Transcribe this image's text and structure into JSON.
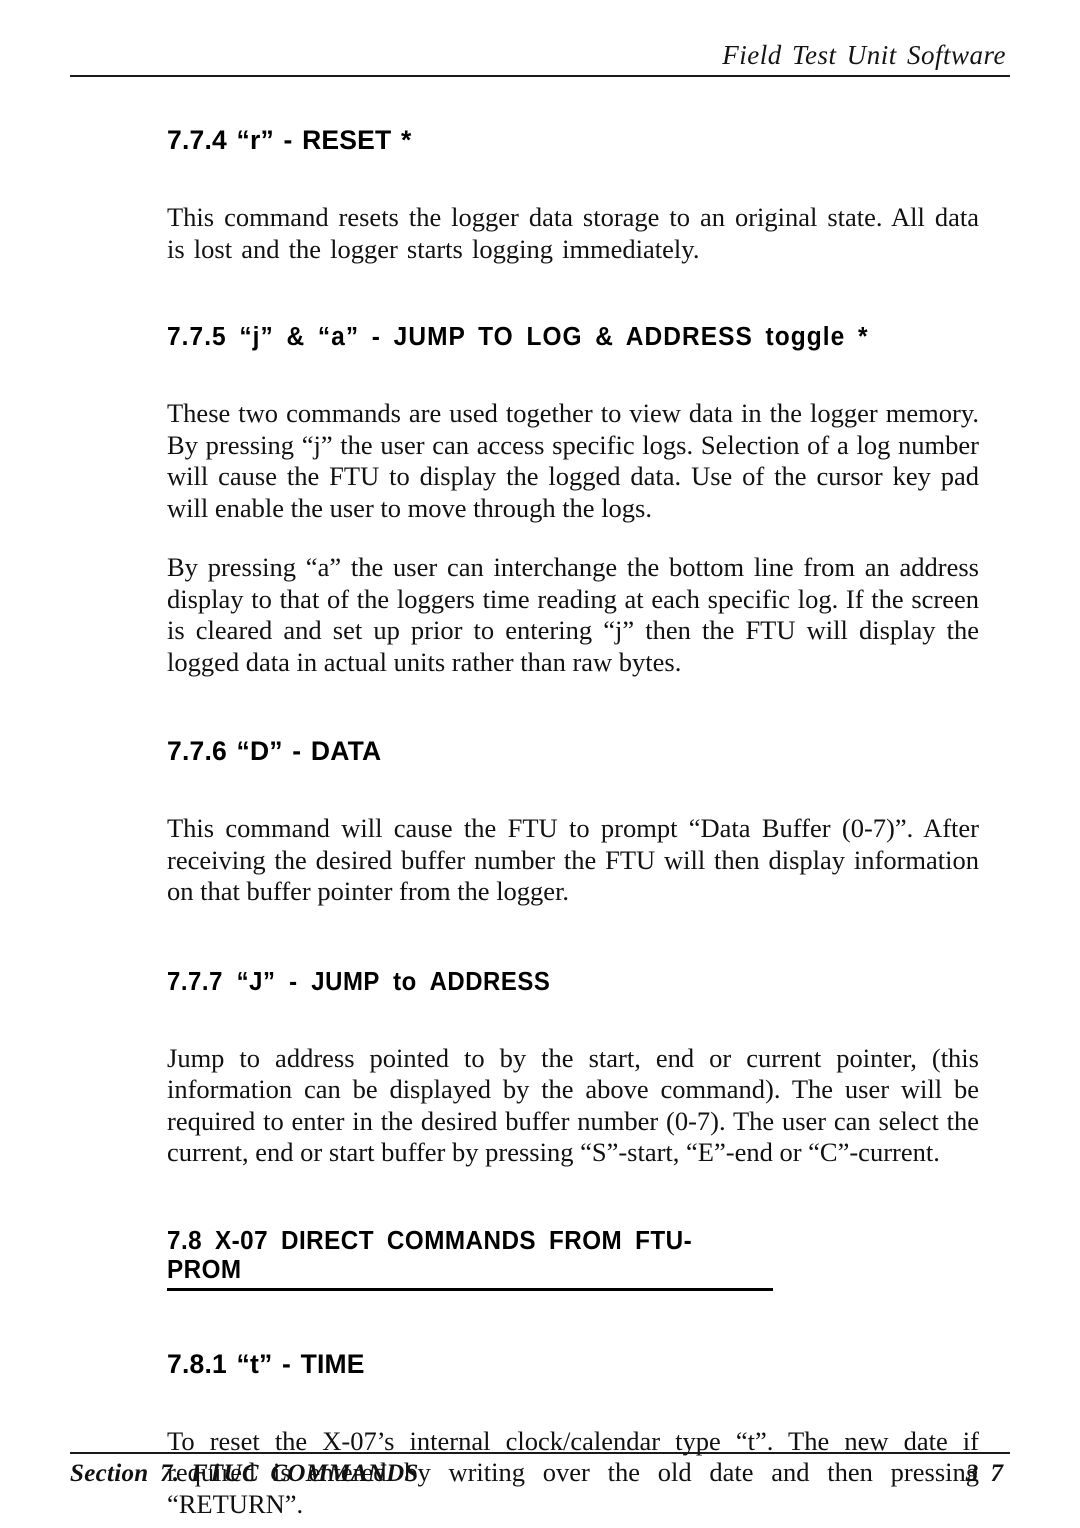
{
  "header": {
    "running_title": "Field Test Unit Software"
  },
  "sections": [
    {
      "heading": "7.7.4 “r” - RESET *",
      "paragraphs": [
        "This command resets the logger data storage to an original state. All data is lost and the logger starts logging immediately."
      ]
    },
    {
      "heading": "7.7.5 “j” &  “a” - JUMP TO LOG & ADDRESS toggle *",
      "paragraphs": [
        "These two commands are used together to view data in the logger memory. By pressing “j” the user can access specific logs. Selection of a log number will cause the FTU to display the logged data. Use of the cursor key pad will enable the user to move through the logs.",
        "By pressing “a” the user can interchange the bottom line from an address display to that of the loggers time reading at each specific log. If the screen is cleared and set up prior to entering “j” then the FTU will display the logged data in actual units rather than raw bytes."
      ]
    },
    {
      "heading": "7.7.6 “D” - DATA",
      "paragraphs": [
        "This command will cause the FTU to prompt “Data Buffer (0-7)”. After receiving the desired buffer number the FTU will then display information on that buffer pointer from the logger."
      ]
    },
    {
      "heading": "7.7.7 “J” - JUMP to ADDRESS",
      "paragraphs": [
        "Jump to address pointed to by the start, end or current pointer, (this information can be displayed by the above command). The user will be required to enter in the desired buffer number (0-7). The user can select the current, end or start buffer by pressing “S”-start, “E”-end or “C”-current."
      ]
    },
    {
      "heading": "7.8 X-07 DIRECT COMMANDS FROM FTU-PROM",
      "paragraphs": []
    },
    {
      "heading": "7.8.1 “t” - TIME",
      "paragraphs": [
        "To reset the X-07’s internal clock/calendar type “t”. The new date if required is entered by writing over the old date and then pressing “RETURN”."
      ]
    }
  ],
  "footer": {
    "section_label": "Section  7.  FTUC  COMMANDS",
    "page_number": "3 7"
  }
}
